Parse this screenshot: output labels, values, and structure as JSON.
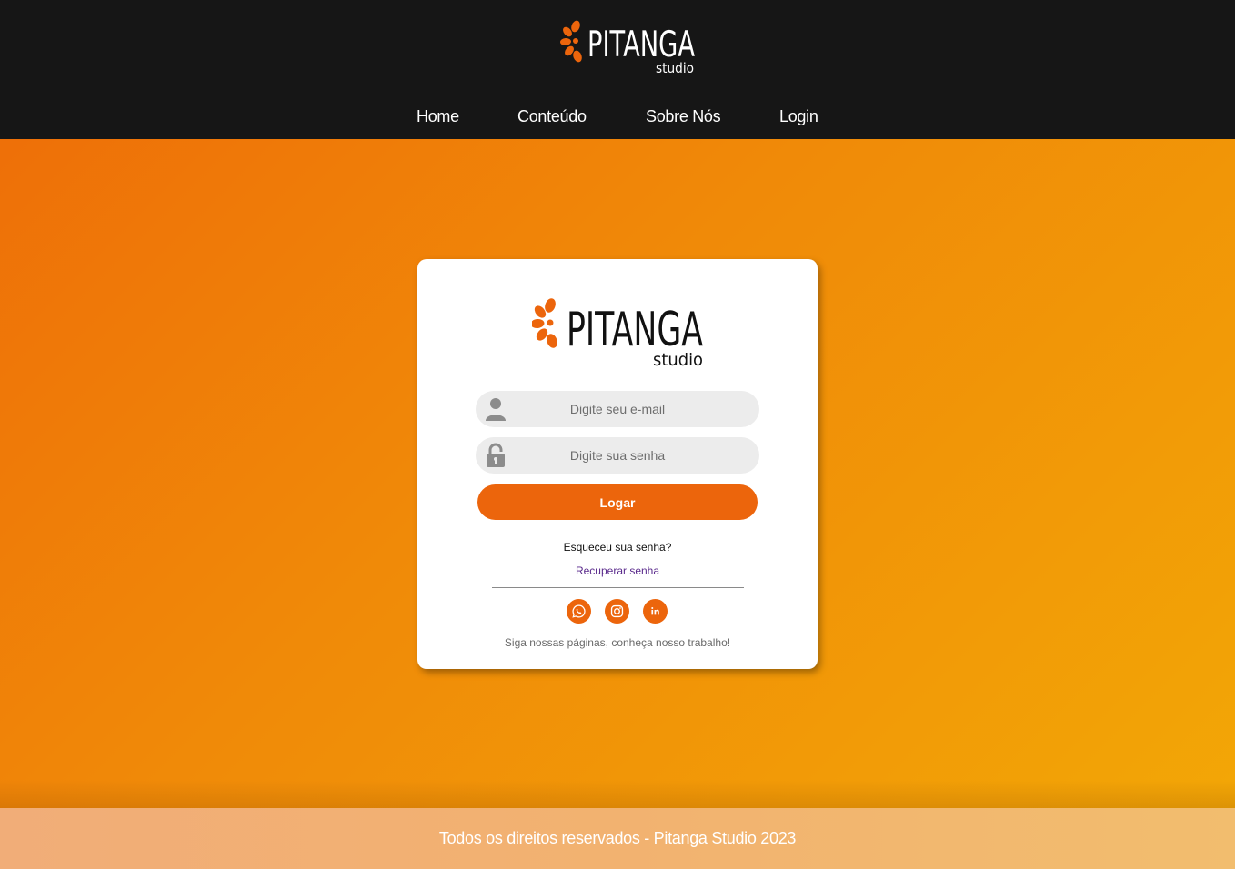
{
  "header": {
    "logo_text": "PITANGA",
    "logo_subtext": "studio",
    "nav": {
      "home": "Home",
      "conteudo": "Conteúdo",
      "sobre": "Sobre Nós",
      "login": "Login"
    }
  },
  "card": {
    "logo_text": "PITANGA",
    "logo_subtext": "studio",
    "email_placeholder": "Digite seu e-mail",
    "password_placeholder": "Digite sua senha",
    "login_button": "Logar",
    "forgot_text": "Esqueceu sua senha?",
    "recover_link": "Recuperar senha",
    "social": [
      "whatsapp-icon",
      "instagram-icon",
      "linkedin-icon"
    ],
    "follow_text": "Siga nossas páginas, conheça nosso trabalho!"
  },
  "footer": {
    "text": "Todos os direitos reservados - Pitanga Studio 2023"
  },
  "colors": {
    "accent": "#ec650c",
    "header_bg": "#161616",
    "gradient_start": "#ee6b08",
    "gradient_end": "#f3a806",
    "link": "#5a2a8c"
  }
}
